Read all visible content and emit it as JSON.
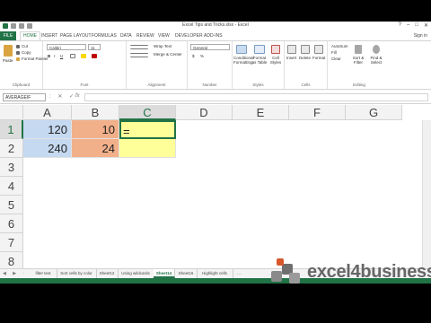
{
  "window": {
    "title": "Excel Tips and Tricks.xlsx - Excel",
    "controls": [
      "?",
      "–",
      "□",
      "✕"
    ]
  },
  "ribbon_tabs": {
    "file": "FILE",
    "items": [
      "HOME",
      "INSERT",
      "PAGE LAYOUT",
      "FORMULAS",
      "DATA",
      "REVIEW",
      "VIEW",
      "DEVELOPER",
      "ADD-INS"
    ],
    "sign_in": "Sign in"
  },
  "ribbon": {
    "clipboard": {
      "label": "Clipboard",
      "paste": "Paste",
      "cut": "Cut",
      "copy": "Copy",
      "format_painter": "Format Painter"
    },
    "font": {
      "label": "Font",
      "font_name": "Calibri",
      "font_size": "11",
      "bold": "B",
      "italic": "I",
      "underline": "U"
    },
    "alignment": {
      "label": "Alignment",
      "wrap_text": "Wrap Text",
      "merge_center": "Merge & Center"
    },
    "number": {
      "label": "Number",
      "format": "General",
      "currency": "$",
      "percent": "%"
    },
    "styles": {
      "label": "Styles",
      "conditional": "Conditional Formatting",
      "format_table": "Format as Table",
      "cell_styles": "Cell Styles"
    },
    "cells": {
      "label": "Cells",
      "insert": "Insert",
      "delete": "Delete",
      "format": "Format"
    },
    "editing": {
      "label": "Editing",
      "autosum": "AutoSum",
      "fill": "Fill",
      "clear": "Clear",
      "sort_filter": "Sort & Filter",
      "find_select": "Find & Select"
    }
  },
  "formula_bar": {
    "name_box": "AVERAGEIF",
    "fx": "fx",
    "value": ""
  },
  "grid": {
    "columns": [
      "A",
      "B",
      "C",
      "D",
      "E",
      "F",
      "G"
    ],
    "rows": [
      "1",
      "2",
      "3",
      "4",
      "5",
      "6",
      "7",
      "8"
    ],
    "cells": {
      "A1": "120",
      "B1": "10",
      "C1": "=",
      "A2": "240",
      "B2": "24"
    }
  },
  "colors": {
    "excel_green": "#217346",
    "col_a_fill": "#c5d9f1",
    "col_b_fill": "#f2b08a",
    "col_c_fill": "#ffff99"
  },
  "sheet_tabs": {
    "items": [
      "filter text",
      "Sort cells by color",
      "Sheet12",
      "Using wildcards",
      "Sheet14",
      "Sheet16",
      "Highlight cells"
    ],
    "active": "Sheet14",
    "more": "..."
  },
  "watermark": {
    "text": "excel4business"
  }
}
